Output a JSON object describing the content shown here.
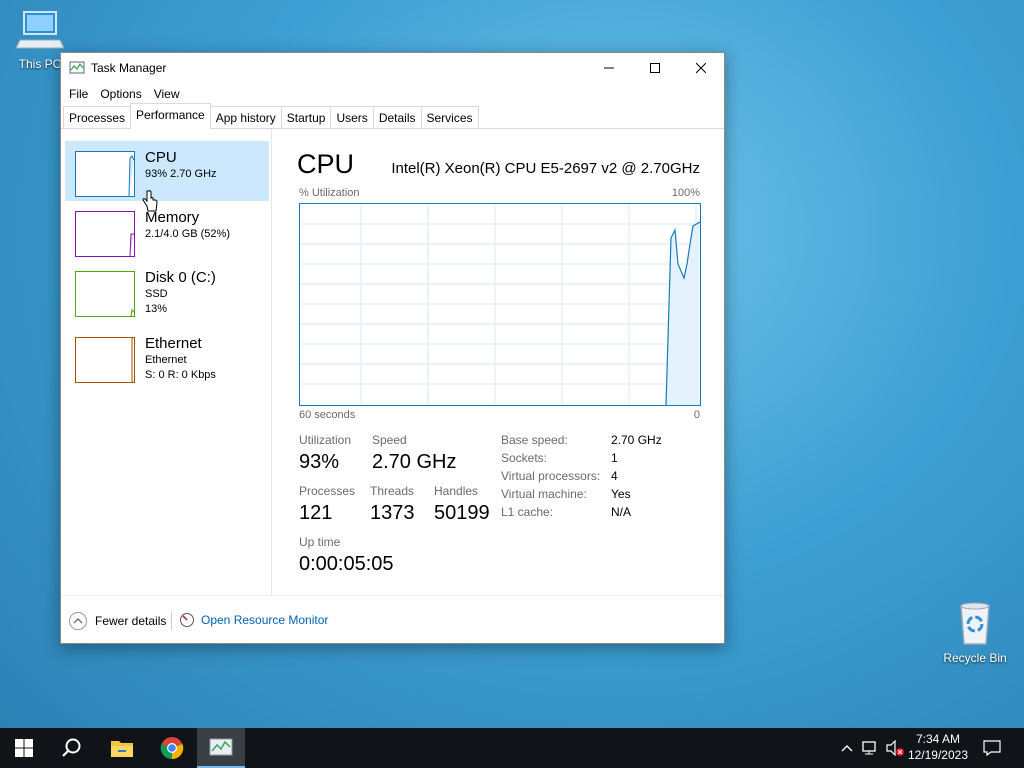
{
  "desktop": {
    "this_pc_label": "This PC",
    "recycle_bin_label": "Recycle Bin"
  },
  "window": {
    "title": "Task Manager",
    "menu": [
      "File",
      "Options",
      "View"
    ],
    "tabs": [
      "Processes",
      "Performance",
      "App history",
      "Startup",
      "Users",
      "Details",
      "Services"
    ],
    "active_tab": "Performance"
  },
  "sidebar": {
    "items": [
      {
        "name": "CPU",
        "line1": "93%  2.70 GHz",
        "line2": "",
        "color": "#117dbb"
      },
      {
        "name": "Memory",
        "line1": "2.1/4.0 GB (52%)",
        "line2": "",
        "color": "#8b12ae"
      },
      {
        "name": "Disk 0 (C:)",
        "line1": "SSD",
        "line2": "13%",
        "color": "#4da60c"
      },
      {
        "name": "Ethernet",
        "line1": "Ethernet",
        "line2": "S: 0  R: 0 Kbps",
        "color": "#a74f01"
      }
    ]
  },
  "main": {
    "title": "CPU",
    "model": "Intel(R) Xeon(R) CPU E5-2697 v2 @ 2.70GHz",
    "util_label": "% Utilization",
    "max_label": "100%",
    "time_label": "60 seconds",
    "zero_label": "0",
    "stats": {
      "utilization_label": "Utilization",
      "utilization": "93%",
      "speed_label": "Speed",
      "speed": "2.70 GHz",
      "processes_label": "Processes",
      "processes": "121",
      "threads_label": "Threads",
      "threads": "1373",
      "handles_label": "Handles",
      "handles": "50199",
      "uptime_label": "Up time",
      "uptime": "0:00:05:05"
    },
    "details": [
      {
        "key": "Base speed:",
        "value": "2.70 GHz"
      },
      {
        "key": "Sockets:",
        "value": "1"
      },
      {
        "key": "Virtual processors:",
        "value": "4"
      },
      {
        "key": "Virtual machine:",
        "value": "Yes"
      },
      {
        "key": "L1 cache:",
        "value": "N/A"
      }
    ]
  },
  "footer": {
    "fewer_details": "Fewer details",
    "open_resource_monitor": "Open Resource Monitor"
  },
  "taskbar": {
    "time": "7:34 AM",
    "date": "12/19/2023"
  },
  "colors": {
    "cpu_line": "#117dbb",
    "selected_bg": "#cce8ff",
    "link": "#0063b1"
  }
}
